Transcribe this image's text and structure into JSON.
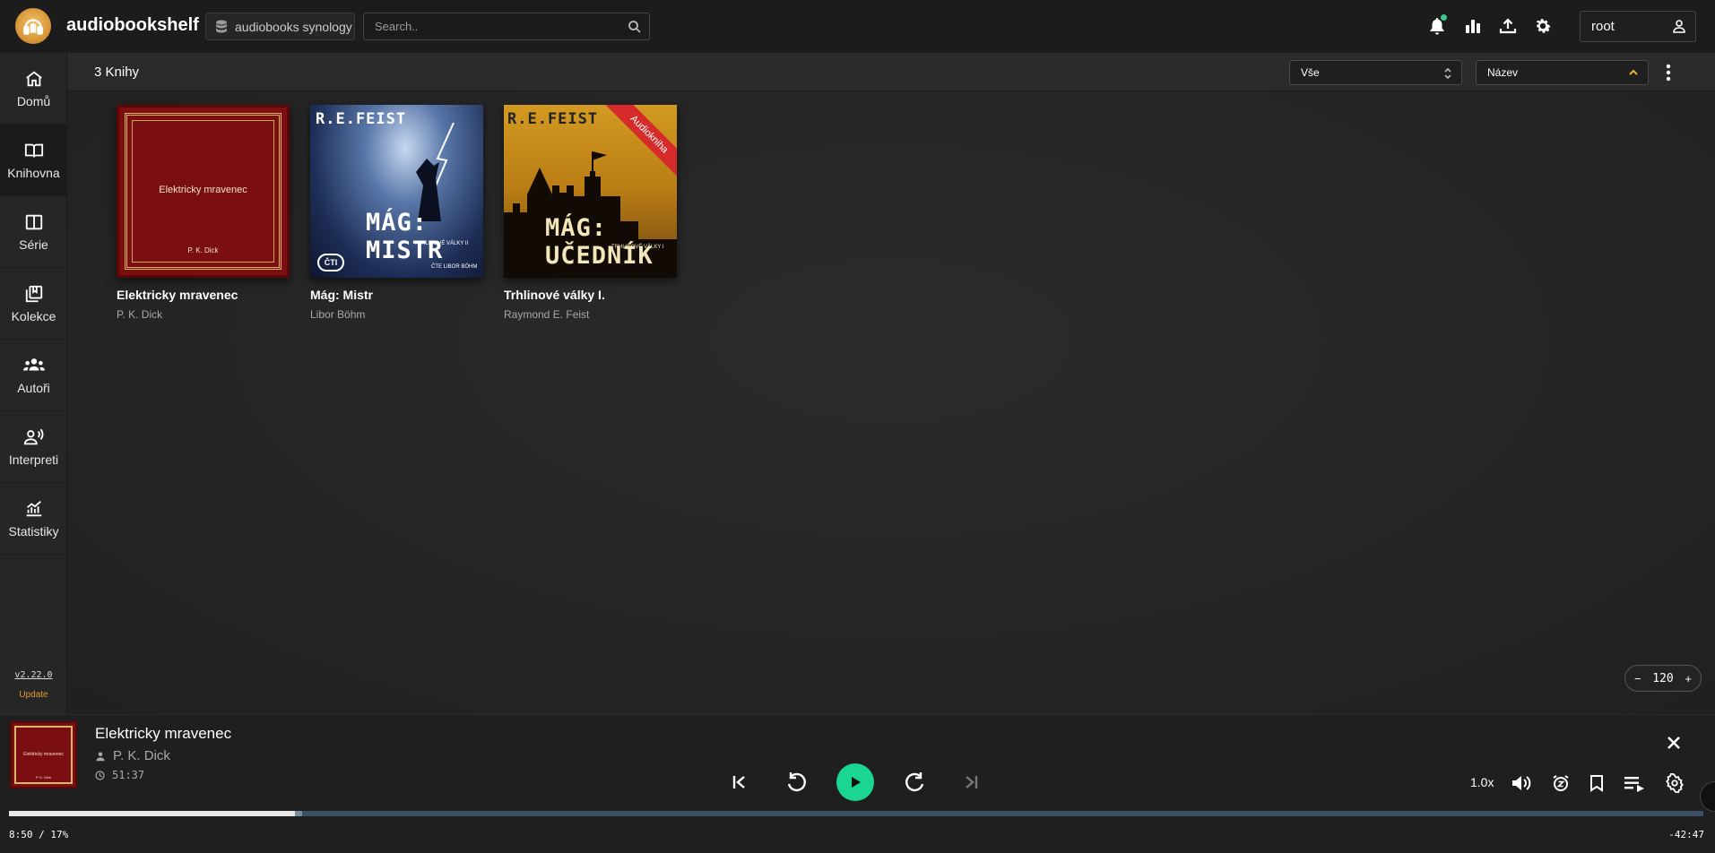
{
  "app": {
    "title": "audiobookshelf",
    "library": "audiobooks synology",
    "search_placeholder": "Search..",
    "user": "root"
  },
  "sidebar": {
    "items": [
      {
        "label": "Domů",
        "icon": "home-icon"
      },
      {
        "label": "Knihovna",
        "icon": "book-open-icon",
        "active": true
      },
      {
        "label": "Série",
        "icon": "columns-icon"
      },
      {
        "label": "Kolekce",
        "icon": "collection-icon"
      },
      {
        "label": "Autoři",
        "icon": "users-icon"
      },
      {
        "label": "Interpreti",
        "icon": "narrator-icon"
      },
      {
        "label": "Statistiky",
        "icon": "stats-icon"
      }
    ],
    "version": "v2.22.0",
    "update": "Update"
  },
  "toolbar": {
    "count": "3 Knihy",
    "filter": "Vše",
    "sort": "Název"
  },
  "books": [
    {
      "title": "Elektricky mravenec",
      "author": "P. K. Dick",
      "cover_title": "Elektricky mravenec",
      "cover_author": "P. K. Dick"
    },
    {
      "title": "Mág: Mistr",
      "author": "Libor Böhm",
      "cover_top": "R.E.FEIST",
      "cover_big": "MÁG: MISTR",
      "cover_sub": "TRHLINOVÉ VÁLKY II",
      "cover_reader": "ČTE LIBOR BÖHM",
      "cover_badge": "ČTI"
    },
    {
      "title": "Trhlinové války I.",
      "author": "Raymond E. Feist",
      "cover_top": "R.E.FEIST",
      "cover_big": "MÁG: UČEDNÍK",
      "cover_sub": "TRHLINOVÉ VÁLKY I",
      "ribbon": "Audiokniha"
    }
  ],
  "zoom": {
    "minus": "−",
    "value": "120",
    "plus": "+"
  },
  "player": {
    "title": "Elektricky mravenec",
    "author": "P. K. Dick",
    "duration": "51:37",
    "cover_title": "Elektricky mravenec",
    "cover_author": "P. K. Dick",
    "speed": "1.0x",
    "time_current": "8:50 / 17%",
    "time_remaining": "-42:47",
    "progress_percent": 17
  },
  "colors": {
    "accent": "#1ad691",
    "update": "#e39a2b",
    "ribbon": "#d62b2b"
  }
}
